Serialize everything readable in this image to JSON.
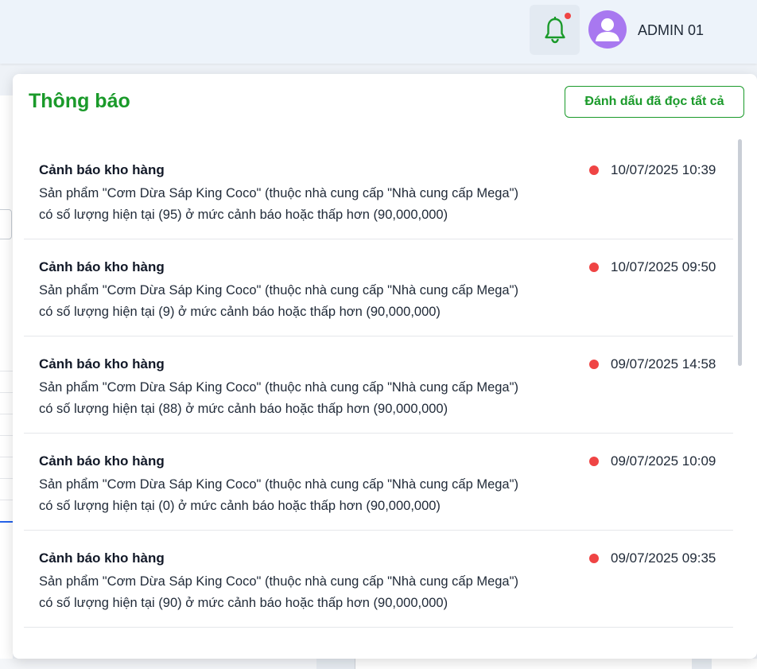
{
  "header": {
    "user_name": "ADMIN 01",
    "bell_icon": "bell-icon",
    "avatar_icon": "user-avatar-icon",
    "accent_color": "#1a9a2a",
    "badge_color": "#ef4444"
  },
  "panel": {
    "title": "Thông báo",
    "mark_all_label": "Đánh dấu đã đọc tất cả"
  },
  "notifications": [
    {
      "title": "Cảnh báo kho hàng",
      "line1": "Sản phẩm \"Cơm Dừa Sáp King Coco\" (thuộc nhà cung cấp \"Nhà cung cấp Mega\")",
      "line2": "có số lượng hiện tại (95) ở mức cảnh báo hoặc thấp hơn (90,000,000)",
      "time": "10/07/2025 10:39",
      "unread": true
    },
    {
      "title": "Cảnh báo kho hàng",
      "line1": "Sản phẩm \"Cơm Dừa Sáp King Coco\" (thuộc nhà cung cấp \"Nhà cung cấp Mega\")",
      "line2": "có số lượng hiện tại (9) ở mức cảnh báo hoặc thấp hơn (90,000,000)",
      "time": "10/07/2025 09:50",
      "unread": true
    },
    {
      "title": "Cảnh báo kho hàng",
      "line1": "Sản phẩm \"Cơm Dừa Sáp King Coco\" (thuộc nhà cung cấp \"Nhà cung cấp Mega\")",
      "line2": "có số lượng hiện tại (88) ở mức cảnh báo hoặc thấp hơn (90,000,000)",
      "time": "09/07/2025 14:58",
      "unread": true
    },
    {
      "title": "Cảnh báo kho hàng",
      "line1": "Sản phẩm \"Cơm Dừa Sáp King Coco\" (thuộc nhà cung cấp \"Nhà cung cấp Mega\")",
      "line2": "có số lượng hiện tại (0) ở mức cảnh báo hoặc thấp hơn (90,000,000)",
      "time": "09/07/2025 10:09",
      "unread": true
    },
    {
      "title": "Cảnh báo kho hàng",
      "line1": "Sản phẩm \"Cơm Dừa Sáp King Coco\" (thuộc nhà cung cấp \"Nhà cung cấp Mega\")",
      "line2": "có số lượng hiện tại (90) ở mức cảnh báo hoặc thấp hơn (90,000,000)",
      "time": "09/07/2025 09:35",
      "unread": true
    }
  ]
}
